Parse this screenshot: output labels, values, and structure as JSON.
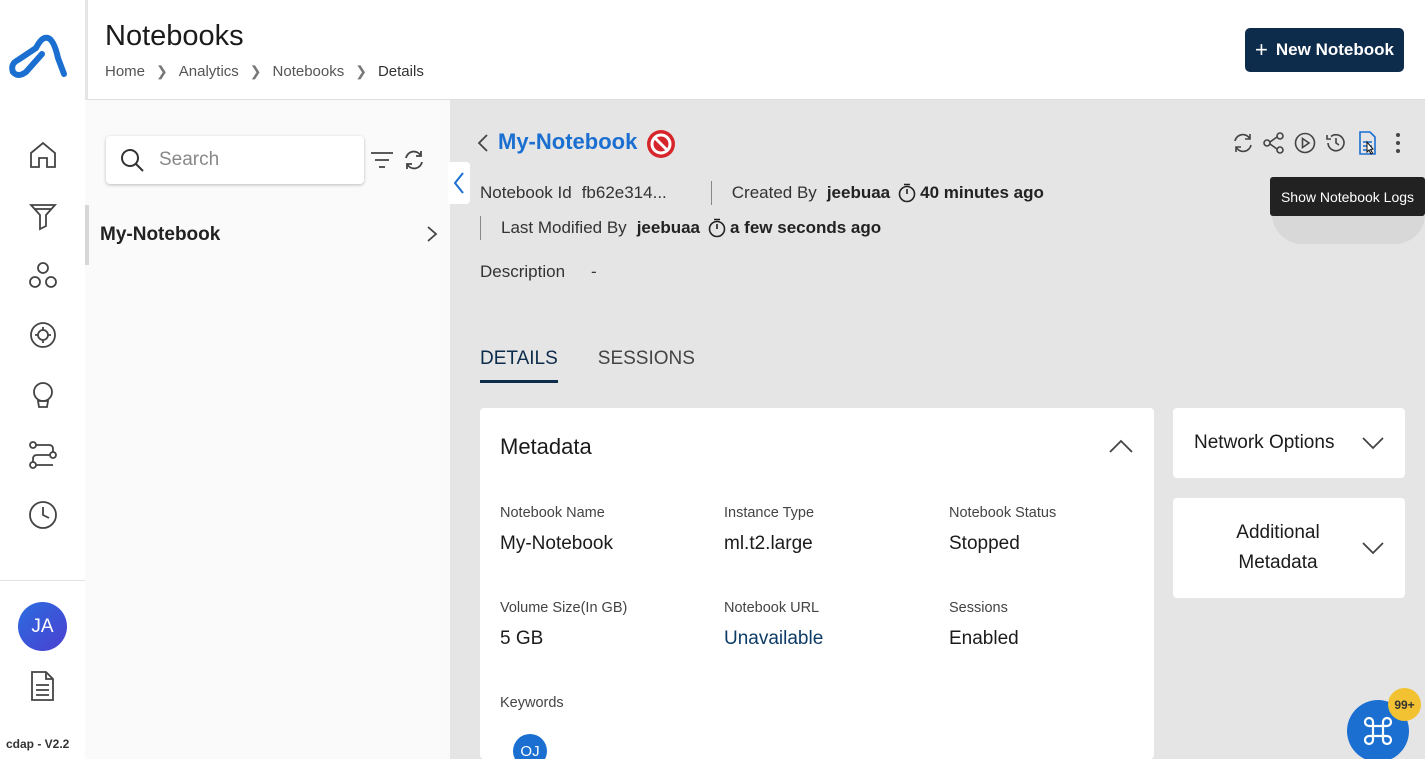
{
  "header": {
    "title": "Notebooks",
    "breadcrumb": [
      "Home",
      "Analytics",
      "Notebooks",
      "Details"
    ],
    "new_button_label": "New Notebook"
  },
  "rail": {
    "nav_icons": [
      "home-icon",
      "filter-funnel-icon",
      "nodes-icon",
      "settings-gear-icon",
      "lightbulb-icon",
      "pipeline-icon",
      "clock-icon"
    ],
    "avatar_initials": "JA",
    "version": "cdap - V2.2"
  },
  "list": {
    "search_placeholder": "Search",
    "items": [
      {
        "label": "My-Notebook"
      }
    ]
  },
  "detail": {
    "title": "My-Notebook",
    "notebook_id_label": "Notebook Id",
    "notebook_id_value": "fb62e314...",
    "created_by_label": "Created By",
    "created_by_value": "jeebuaa",
    "created_time": "40 minutes ago",
    "modified_by_label": "Last Modified By",
    "modified_by_value": "jeebuaa",
    "modified_time": "a few seconds ago",
    "description_label": "Description",
    "description_value": "-",
    "toolbar_icons": [
      "sync-icon",
      "share-icon",
      "play-icon",
      "history-icon",
      "notebook-logs-icon",
      "more-vertical-icon"
    ],
    "tooltip": "Show Notebook Logs"
  },
  "tabs": [
    "DETAILS",
    "SESSIONS"
  ],
  "metadata": {
    "title": "Metadata",
    "fields": [
      {
        "k": "Notebook Name",
        "v": "My-Notebook"
      },
      {
        "k": "Instance Type",
        "v": "ml.t2.large"
      },
      {
        "k": "Notebook Status",
        "v": "Stopped"
      },
      {
        "k": "Volume Size(In GB)",
        "v": "5 GB"
      },
      {
        "k": "Notebook URL",
        "v": "Unavailable"
      },
      {
        "k": "Sessions",
        "v": "Enabled"
      }
    ],
    "keywords_label": "Keywords",
    "keyword_chip": "OJ"
  },
  "side": {
    "network_options": "Network Options",
    "additional_metadata_1": "Additional",
    "additional_metadata_2": "Metadata"
  },
  "fab": {
    "badge": "99+"
  },
  "colors": {
    "brand": "#1a6fd1",
    "dark": "#0d2b4a",
    "stop": "#d7262b"
  }
}
